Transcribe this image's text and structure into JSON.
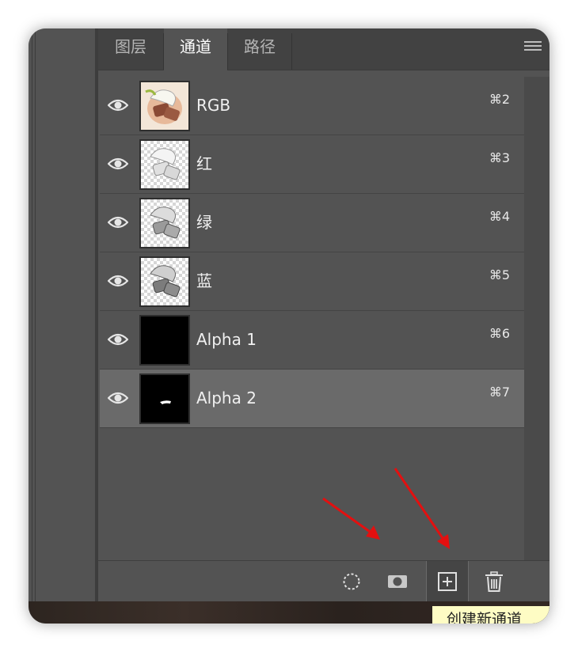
{
  "tabs": [
    {
      "label": "图层"
    },
    {
      "label": "通道"
    },
    {
      "label": "路径"
    }
  ],
  "active_tab": "通道",
  "channels": [
    {
      "name": "RGB",
      "shortcut": "⌘2",
      "thumbnail": "color-photo"
    },
    {
      "name": "红",
      "shortcut": "⌘3",
      "thumbnail": "grayscale-photo"
    },
    {
      "name": "绿",
      "shortcut": "⌘4",
      "thumbnail": "grayscale-photo"
    },
    {
      "name": "蓝",
      "shortcut": "⌘5",
      "thumbnail": "grayscale-photo"
    },
    {
      "name": "Alpha 1",
      "shortcut": "⌘6",
      "thumbnail": "black"
    },
    {
      "name": "Alpha 2",
      "shortcut": "⌘7",
      "thumbnail": "black-with-white-mark"
    }
  ],
  "selected_channel": "Alpha 2",
  "toolbar": {
    "icons": [
      "load-selection-icon",
      "save-selection-icon",
      "new-channel-icon",
      "trash-icon"
    ]
  },
  "tooltip": {
    "text": "创建新通道"
  },
  "colors": {
    "panel_bg": "#535353",
    "tab_bar_bg": "#424242",
    "selected_row": "#6a6a6a",
    "annotation_arrow": "#e31010",
    "tooltip_bg": "#fefcc4"
  }
}
